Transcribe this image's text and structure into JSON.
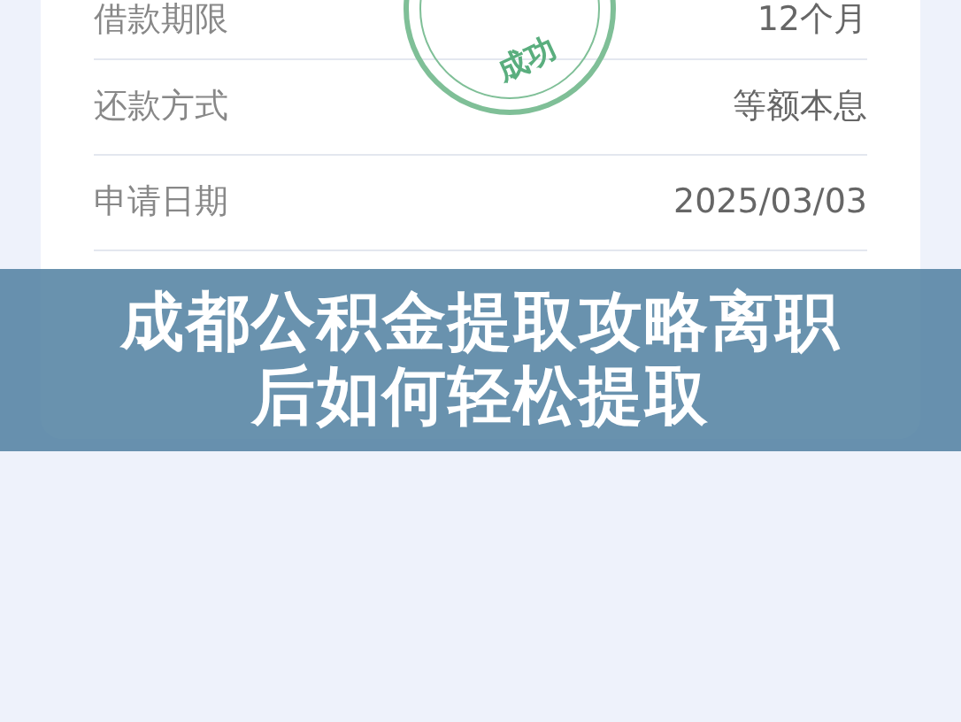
{
  "details": [
    {
      "label": "借款期限",
      "value": "12个月"
    },
    {
      "label": "还款方式",
      "value": "等额本息"
    },
    {
      "label": "申请日期",
      "value": "2025/03/03"
    }
  ],
  "stamp": {
    "text": "成功"
  },
  "banner": {
    "title": "成都公积金提取攻略离职后如何轻松提取"
  }
}
